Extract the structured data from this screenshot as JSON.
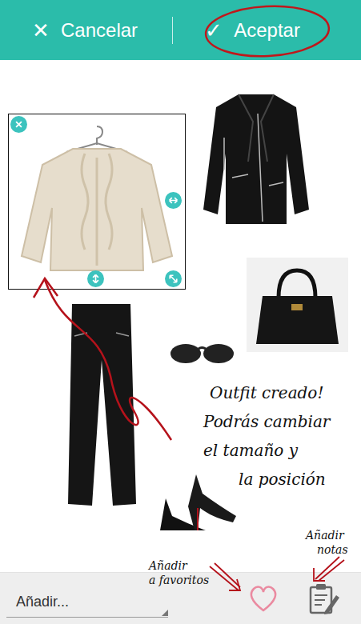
{
  "toolbar": {
    "cancel": {
      "icon": "✕",
      "label": "Cancelar"
    },
    "accept": {
      "icon": "✓",
      "label": "Aceptar"
    }
  },
  "canvas": {
    "items": [
      {
        "kind": "sweater",
        "selected": true
      },
      {
        "kind": "jacket",
        "selected": false
      },
      {
        "kind": "bag",
        "selected": false
      },
      {
        "kind": "sunglasses",
        "selected": false
      },
      {
        "kind": "pants",
        "selected": false
      },
      {
        "kind": "heels",
        "selected": false
      }
    ]
  },
  "annotations": {
    "note_lines": [
      "Outfit creado!",
      "Podrás cambiar",
      "el tamaño y",
      "la posición"
    ],
    "favorites_lines": [
      "Añadir",
      "a favoritos"
    ],
    "notes_lines": [
      "Añadir",
      "notas"
    ]
  },
  "bottom_bar": {
    "dropdown": {
      "value": "Añadir..."
    },
    "favorite": {
      "on": false
    }
  }
}
